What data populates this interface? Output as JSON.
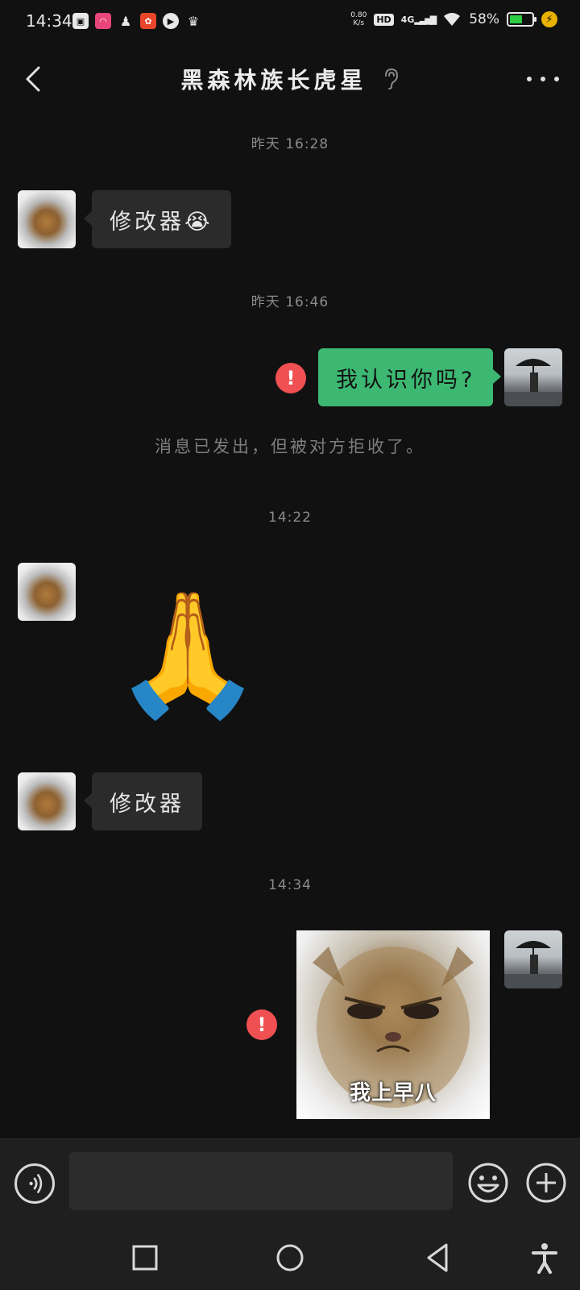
{
  "status_bar": {
    "time": "14:34",
    "app_icons": [
      "gallery-icon",
      "weibo-icon",
      "qq-icon",
      "pinduoduo-icon",
      "play-icon",
      "crown-icon"
    ],
    "net_speed_value": "0.80",
    "net_speed_unit": "K/s",
    "hd": "HD",
    "network": "4G",
    "battery_percent": "58%",
    "battery_level": 0.58,
    "charging": true
  },
  "header": {
    "title": "黑森林族长虎星"
  },
  "messages": {
    "ts1": "昨天 16:28",
    "m1_text": "修改器😭",
    "ts2": "昨天 16:46",
    "m2_text": "我认识你吗?",
    "m2_error": "!",
    "system_notice": "消息已发出，但被对方拒收了。",
    "ts3": "14:22",
    "m3_emoji": "🙏",
    "m4_text": "修改器",
    "ts4": "14:34",
    "m5_sticker_caption": "我上早八",
    "m5_error": "!"
  },
  "colors": {
    "background": "#111111",
    "outgoing_bubble": "#3cb872",
    "incoming_bubble": "#2b2b2b",
    "error_badge": "#f05052",
    "battery": "#2ecc40"
  }
}
